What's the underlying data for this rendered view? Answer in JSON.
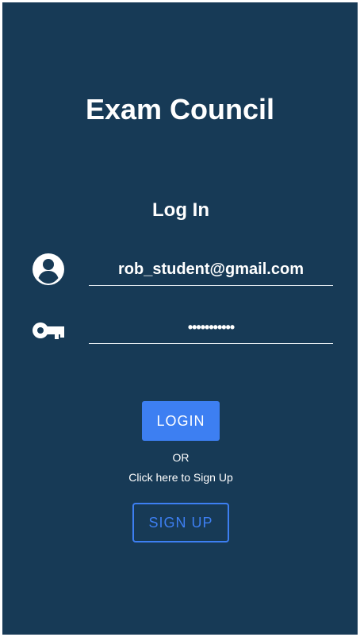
{
  "app": {
    "title": "Exam Council"
  },
  "form": {
    "heading": "Log In",
    "email": {
      "value": "rob_student@gmail.com",
      "icon": "account-circle-icon"
    },
    "password": {
      "value": "•••••••••••",
      "icon": "key-icon"
    },
    "login_label": "LOGIN",
    "or_label": "OR",
    "signup_hint": "Click here to Sign Up",
    "signup_label": "SIGN UP"
  },
  "colors": {
    "background": "#173a56",
    "accent": "#3d7ff2",
    "text": "#ffffff"
  }
}
